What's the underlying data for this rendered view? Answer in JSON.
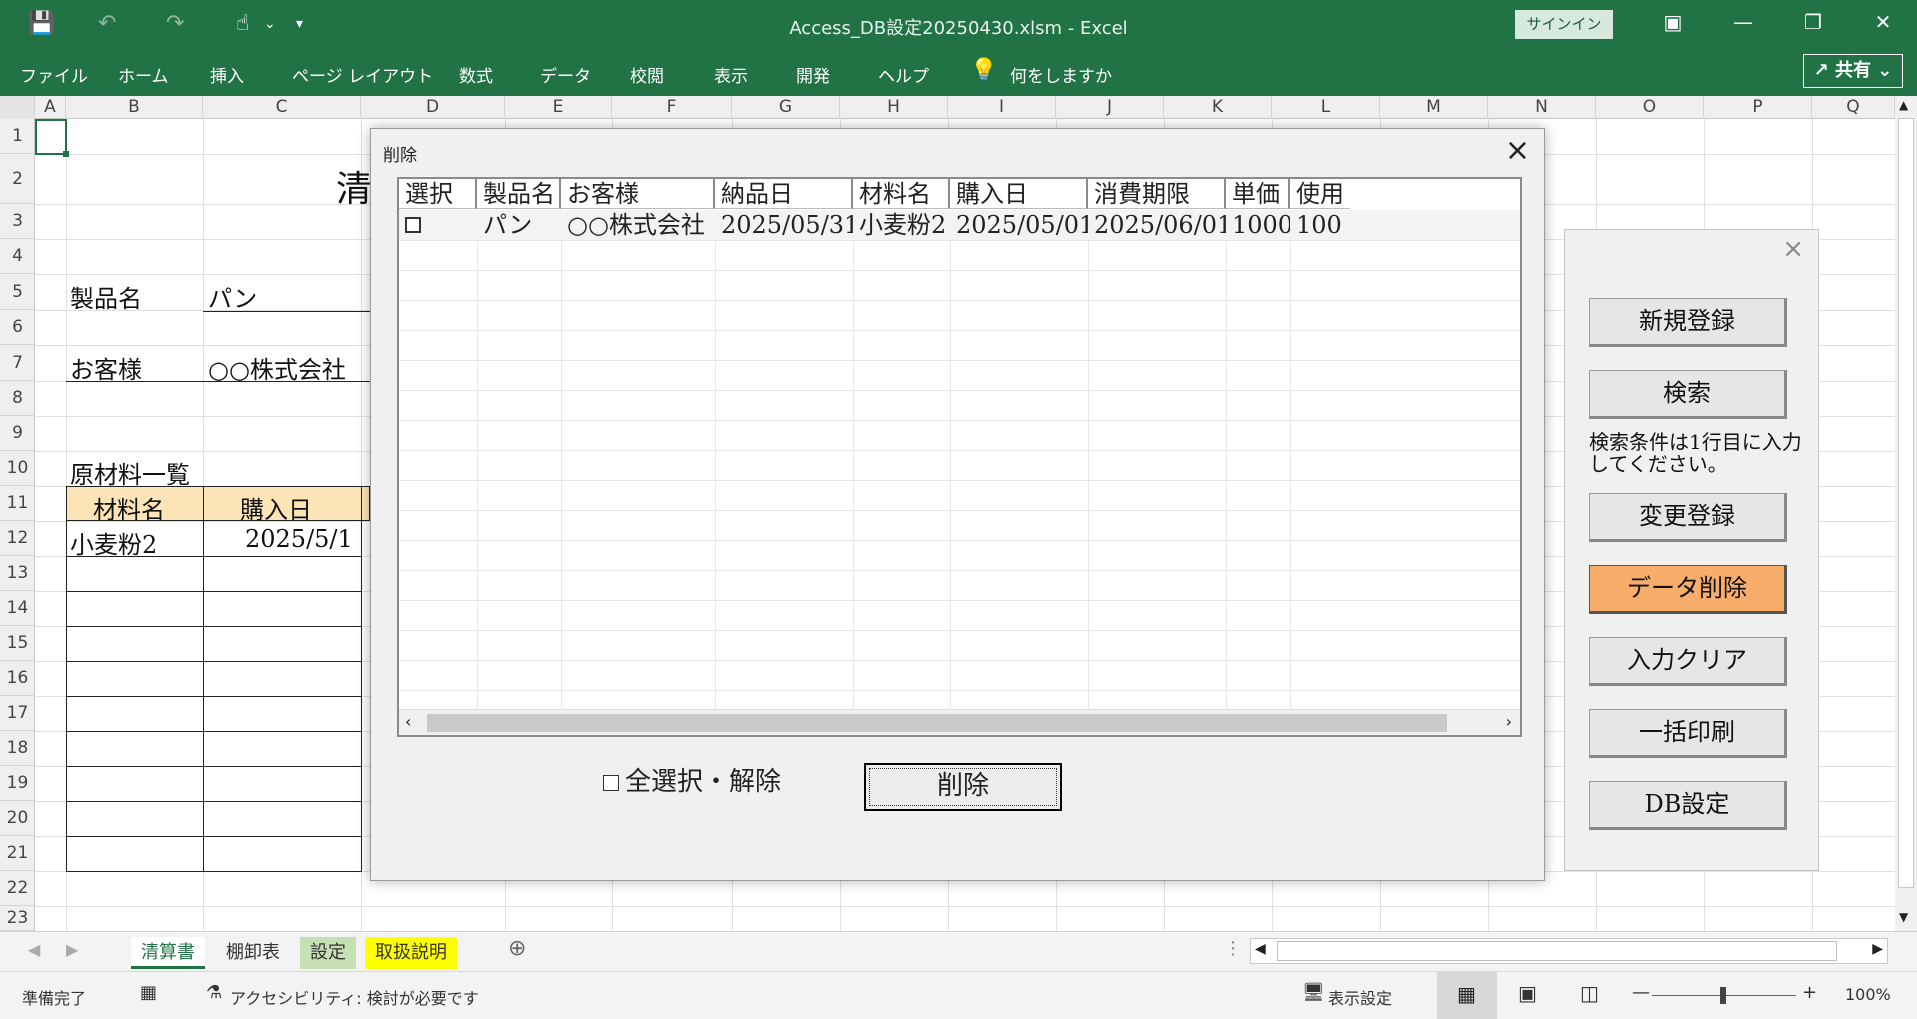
{
  "window": {
    "title": "Access_DB設定20250430.xlsm  -  Excel",
    "signin": "サインイン",
    "share": "共有"
  },
  "ribbon": {
    "tabs": [
      "ファイル",
      "ホーム",
      "挿入",
      "ページ レイアウト",
      "数式",
      "データ",
      "校閲",
      "表示",
      "開発",
      "ヘルプ"
    ],
    "tellme": "何をしますか"
  },
  "columns": [
    "A",
    "B",
    "C",
    "D",
    "E",
    "F",
    "G",
    "H",
    "I",
    "J",
    "K",
    "L",
    "M",
    "N",
    "O",
    "P",
    "Q"
  ],
  "rows": [
    "1",
    "2",
    "3",
    "4",
    "5",
    "6",
    "7",
    "8",
    "9",
    "10",
    "11",
    "12",
    "13",
    "14",
    "15",
    "16",
    "17",
    "18",
    "19",
    "20",
    "21",
    "22",
    "23"
  ],
  "sheet": {
    "title_partial": "清",
    "product_label": "製品名",
    "product_value": "パン",
    "customer_label": "お客様",
    "customer_value": "○○株式会社",
    "materials_title": "原材料一覧",
    "mat_h1": "材料名",
    "mat_h2": "購入日",
    "mat_r1c1": "小麦粉2",
    "mat_r1c2": "2025/5/1"
  },
  "dialog": {
    "title": "削除",
    "headers": [
      "選択",
      "製品名",
      "お客様",
      "納品日",
      "材料名",
      "購入日",
      "消費期限",
      "単価",
      "使用"
    ],
    "row": [
      "",
      "パン",
      "○○株式会社",
      "2025/05/31",
      "小麦粉2",
      "2025/05/01",
      "2025/06/01",
      "1000",
      "100"
    ],
    "select_all_label": "全選択・解除",
    "delete_button": "削除"
  },
  "panel": {
    "buttons": [
      "新規登録",
      "検索",
      "変更登録",
      "データ削除",
      "入力クリア",
      "一括印刷",
      "DB設定"
    ],
    "note": "検索条件は1行目に入力してください。",
    "active_color": "#f8ad6a"
  },
  "sheet_tabs": [
    "清算書",
    "棚卸表",
    "設定",
    "取扱説明"
  ],
  "status": {
    "ready": "準備完了",
    "accessibility": "アクセシビリティ: 検討が必要です",
    "display": "表示設定",
    "zoom": "100%"
  }
}
